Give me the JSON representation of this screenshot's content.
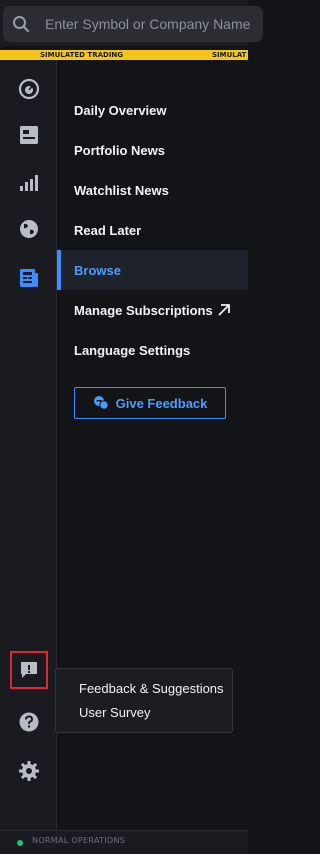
{
  "search": {
    "placeholder": "Enter Symbol or Company Name"
  },
  "banner": {
    "left_text": "SIMULATED TRADING",
    "right_text": "SIMULAT"
  },
  "rail": {
    "items": [
      {
        "icon": "dashboard-gauge-icon"
      },
      {
        "icon": "news-card-icon"
      },
      {
        "icon": "chart-bars-icon"
      },
      {
        "icon": "globe-icon"
      },
      {
        "icon": "newspaper-icon",
        "active": true
      },
      {
        "icon": "feedback-bubble-icon",
        "highlighted": true
      },
      {
        "icon": "help-icon"
      },
      {
        "icon": "gear-icon"
      }
    ]
  },
  "menu": {
    "items": [
      {
        "label": "Daily Overview"
      },
      {
        "label": "Portfolio News"
      },
      {
        "label": "Watchlist News"
      },
      {
        "label": "Read Later"
      },
      {
        "label": "Browse",
        "selected": true
      },
      {
        "label": "Manage Subscriptions",
        "icon": "external-link-icon"
      },
      {
        "label": "Language Settings"
      }
    ],
    "feedback_button": "Give Feedback"
  },
  "popover": {
    "items": [
      "Feedback & Suggestions",
      "User Survey"
    ]
  },
  "status": {
    "text": "NORMAL OPERATIONS",
    "color": "#27c26a"
  },
  "colors": {
    "accent": "#3f8cff",
    "banner": "#f5c518",
    "highlight": "#e0272c"
  }
}
